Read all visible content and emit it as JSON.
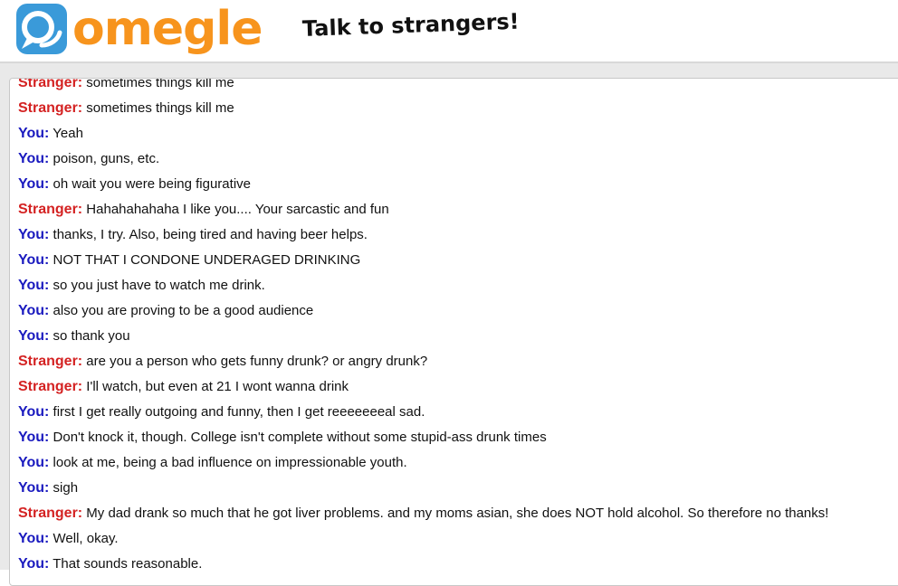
{
  "header": {
    "logo_text": "omegle",
    "tagline": "Talk to strangers!"
  },
  "colors": {
    "logo_orange": "#f7941d",
    "logo_blue": "#3a9ad9",
    "you_color": "#1a1abf",
    "stranger_color": "#d42222"
  },
  "chat": {
    "messages": [
      {
        "speaker": "Stranger",
        "label": "Stranger:",
        "text": "sometimes things kill me"
      },
      {
        "speaker": "Stranger",
        "label": "Stranger:",
        "text": "sometimes things kill me"
      },
      {
        "speaker": "You",
        "label": "You:",
        "text": "Yeah"
      },
      {
        "speaker": "You",
        "label": "You:",
        "text": "poison, guns, etc."
      },
      {
        "speaker": "You",
        "label": "You:",
        "text": "oh wait you were being figurative"
      },
      {
        "speaker": "Stranger",
        "label": "Stranger:",
        "text": "Hahahahahaha I like you.... Your sarcastic and fun"
      },
      {
        "speaker": "You",
        "label": "You:",
        "text": "thanks, I try. Also, being tired and having beer helps."
      },
      {
        "speaker": "You",
        "label": "You:",
        "text": "NOT THAT I CONDONE UNDERAGED DRINKING"
      },
      {
        "speaker": "You",
        "label": "You:",
        "text": "so you just have to watch me drink."
      },
      {
        "speaker": "You",
        "label": "You:",
        "text": "also you are proving to be a good audience"
      },
      {
        "speaker": "You",
        "label": "You:",
        "text": "so thank you"
      },
      {
        "speaker": "Stranger",
        "label": "Stranger:",
        "text": "are you a person who gets funny drunk? or angry drunk?"
      },
      {
        "speaker": "Stranger",
        "label": "Stranger:",
        "text": "I'll watch, but even at 21 I wont wanna drink"
      },
      {
        "speaker": "You",
        "label": "You:",
        "text": "first I get really outgoing and funny, then I get reeeeeeeal sad."
      },
      {
        "speaker": "You",
        "label": "You:",
        "text": "Don't knock it, though. College isn't complete without some stupid-ass drunk times"
      },
      {
        "speaker": "You",
        "label": "You:",
        "text": "look at me, being a bad influence on impressionable youth."
      },
      {
        "speaker": "You",
        "label": "You:",
        "text": "sigh"
      },
      {
        "speaker": "Stranger",
        "label": "Stranger:",
        "text": "My dad drank so much that he got liver problems. and my moms asian, she does NOT hold alcohol. So therefore no thanks!"
      },
      {
        "speaker": "You",
        "label": "You:",
        "text": "Well, okay."
      },
      {
        "speaker": "You",
        "label": "You:",
        "text": "That sounds reasonable."
      }
    ]
  }
}
